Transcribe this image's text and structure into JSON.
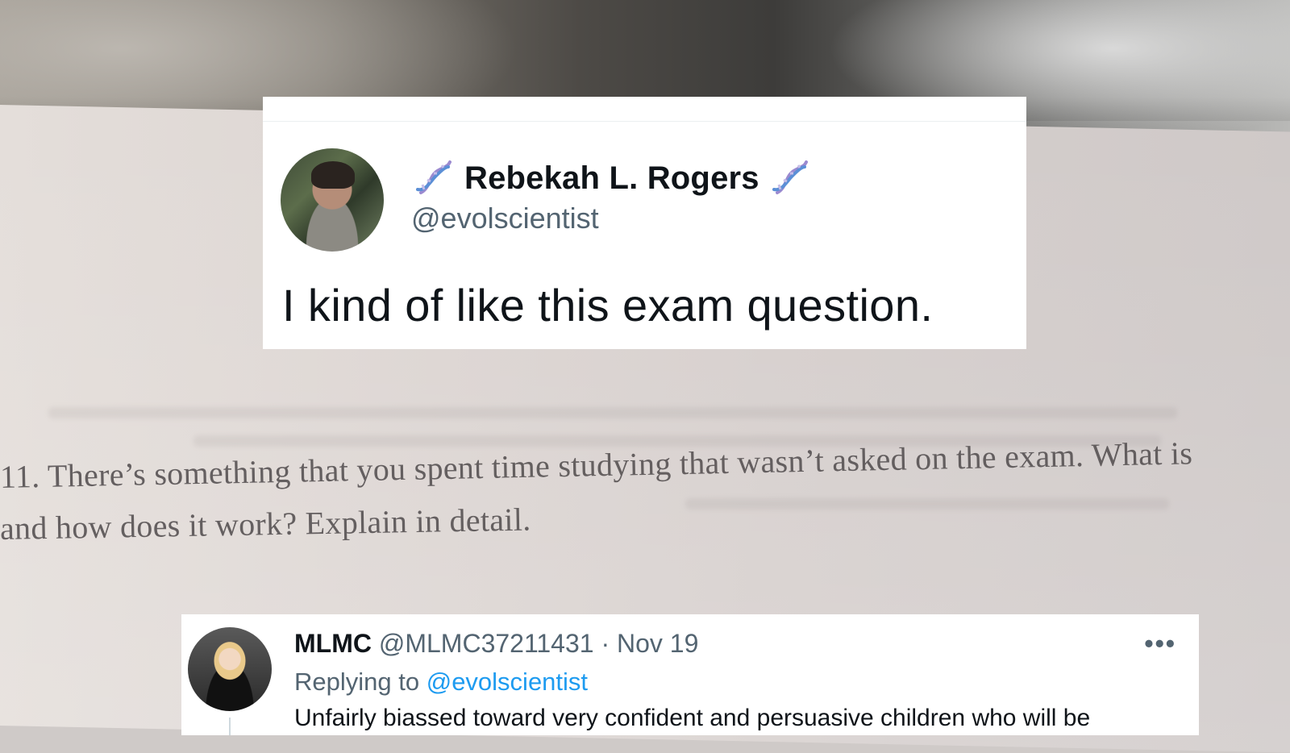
{
  "tweet": {
    "author_name": "Rebekah L. Rogers",
    "author_handle": "@evolscientist",
    "emoji_icon": "dna-icon",
    "text": "I kind of like this exam question."
  },
  "exam": {
    "line1": "11.  There’s something that you spent time studying that wasn’t asked on the exam.  What is",
    "line2": "and how does it work?  Explain in detail."
  },
  "reply": {
    "name": "MLMC",
    "handle": "@MLMC37211431",
    "separator": "·",
    "date": "Nov 19",
    "replying_prefix": "Replying to",
    "replying_handle": "@evolscientist",
    "text": "Unfairly biassed toward very confident and persuasive children who will be",
    "more_icon": "more-options-icon"
  },
  "colors": {
    "link_blue": "#1d9bf0",
    "text_primary": "#0f1419",
    "text_secondary": "#536471",
    "dna_purple": "#9b8ad0",
    "dna_blue": "#5b8fd6"
  }
}
